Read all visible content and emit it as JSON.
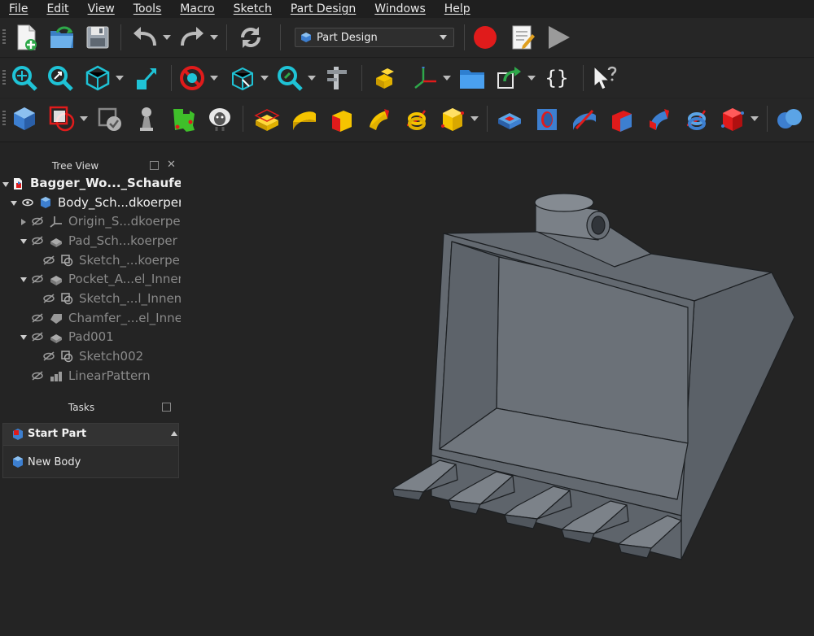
{
  "menubar": {
    "items": [
      "File",
      "Edit",
      "View",
      "Tools",
      "Macro",
      "Sketch",
      "Part Design",
      "Windows",
      "Help"
    ]
  },
  "toolbar": {
    "workbench": "Part Design",
    "braces_label": "{}"
  },
  "tree_view": {
    "title": "Tree View",
    "close_glyph": "✕",
    "items": [
      {
        "label": "Bagger_Wo..._Schaufel",
        "icon": "document-icon"
      },
      {
        "label": "Body_Sch...dkoerper",
        "icon": "body-icon"
      },
      {
        "label": "Origin_S...dkoerper",
        "icon": "origin-icon"
      },
      {
        "label": "Pad_Sch...koerper",
        "icon": "pad-icon"
      },
      {
        "label": "Sketch_...koerper",
        "icon": "sketch-icon"
      },
      {
        "label": "Pocket_A...el_Innen",
        "icon": "pocket-icon"
      },
      {
        "label": "Sketch_...l_Innen",
        "icon": "sketch-icon"
      },
      {
        "label": "Chamfer_...el_Inner",
        "icon": "chamfer-icon"
      },
      {
        "label": "Pad001",
        "icon": "pad-icon"
      },
      {
        "label": "Sketch002",
        "icon": "sketch-icon"
      },
      {
        "label": "LinearPattern",
        "icon": "linear-pattern-icon"
      }
    ]
  },
  "tasks": {
    "title": "Tasks",
    "box_title": "Start Part",
    "action": "New Body"
  },
  "colors": {
    "background": "#242424",
    "model_face_light": "#6b7178",
    "model_face_dark": "#555b62",
    "accent_cyan": "#1fc3d6",
    "accent_yellow": "#f5c400",
    "accent_red": "#e01b1b"
  }
}
